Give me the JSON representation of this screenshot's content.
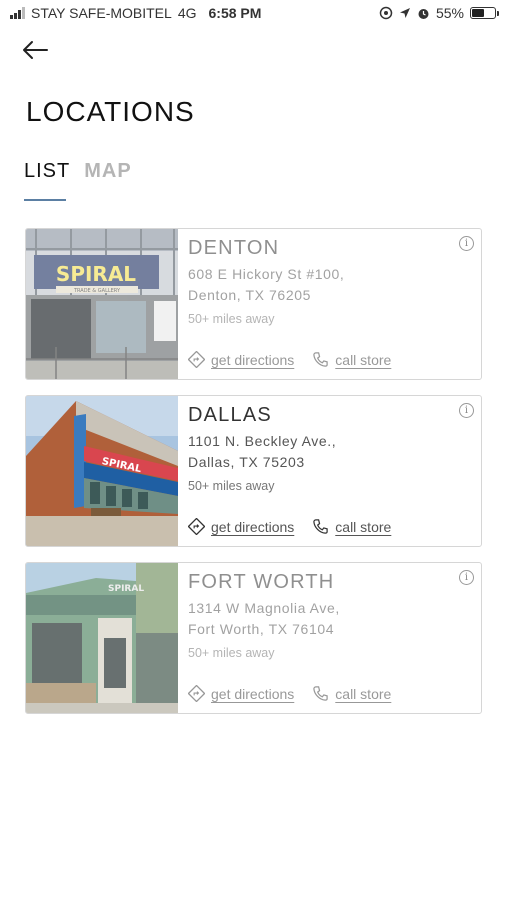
{
  "status_bar": {
    "carrier": "STAY SAFE-MOBITEL",
    "network": "4G",
    "time": "6:58 PM",
    "battery_percent": "55%",
    "battery_level": 0.55
  },
  "header": {
    "title": "LOCATIONS"
  },
  "tabs": [
    {
      "label": "LIST",
      "active": true
    },
    {
      "label": "MAP",
      "active": false
    }
  ],
  "actions": {
    "directions_label": "get directions",
    "call_label": "call store"
  },
  "stores": [
    {
      "name": "DENTON",
      "address_line1": "608 E Hickory St #100,",
      "address_line2": "Denton, TX 76205",
      "distance": "50+ miles away",
      "sign_text": "SPIRAL",
      "sub_sign": "TRADE & GALLERY"
    },
    {
      "name": "DALLAS",
      "address_line1": "1101 N. Beckley Ave.,",
      "address_line2": "Dallas, TX 75203",
      "distance": "50+ miles away",
      "sign_text": "SPIRAL"
    },
    {
      "name": "FORT WORTH",
      "address_line1": "1314 W Magnolia Ave,",
      "address_line2": "Fort Worth, TX 76104",
      "distance": "50+ miles away",
      "sign_text": "SPIRAL"
    }
  ],
  "colors": {
    "tab_underline": "#5b7fa3",
    "card_border": "#d6d6d6"
  }
}
